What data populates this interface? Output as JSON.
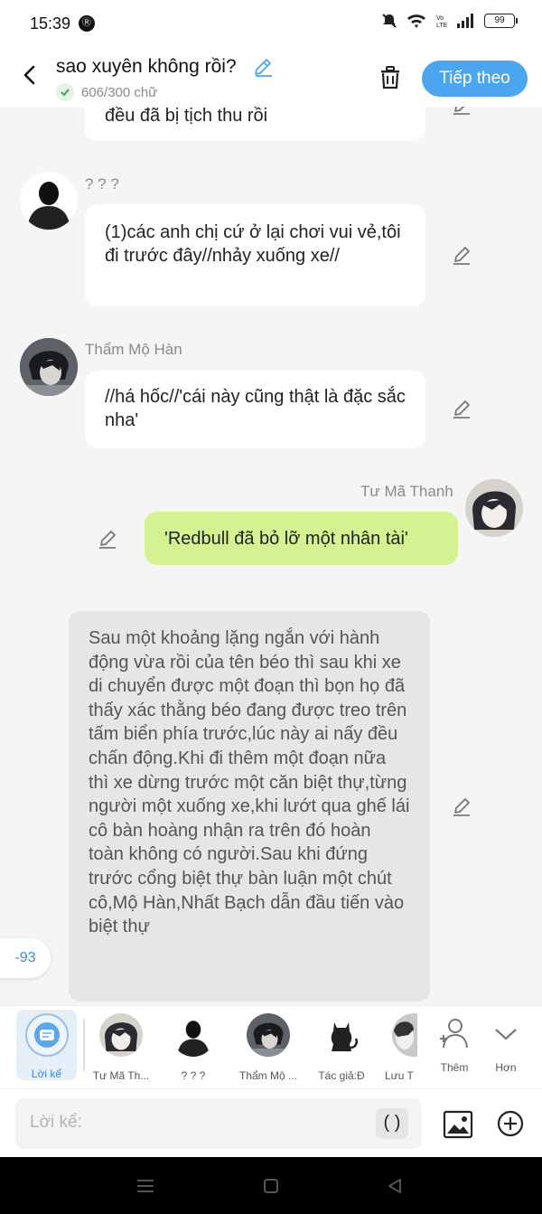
{
  "status_bar": {
    "time": "15:39",
    "battery": "99",
    "app_badge": "Ⓡ"
  },
  "header": {
    "title": "sao xuyên không rồi?",
    "word_count": "606/300 chữ",
    "next_button": "Tiếp theo",
    "icons": [
      "back-icon",
      "pencil-icon",
      "trash-icon"
    ]
  },
  "messages": [
    {
      "type": "bubble",
      "text": "đều đã bị tịch thu rồi"
    },
    {
      "type": "bubble",
      "speaker": "? ? ?",
      "text": "(1)các anh chị cứ ở lại chơi vui vẻ,tôi đi trước đây//nhảy xuống xe//"
    },
    {
      "type": "bubble",
      "speaker": "Thẩm Mộ Hàn",
      "text": "//há hốc//'cái này cũng thật là đặc sắc nha'"
    },
    {
      "type": "bubble-right",
      "speaker": "Tư Mã Thanh",
      "text": "'Redbull đã bỏ lỡ một nhân tài'"
    },
    {
      "type": "narration",
      "text": "Sau một khoảng lặng ngắn với hành động vừa rồi của tên béo thì sau khi xe di chuyển được một đoạn thì bọn họ đã thấy xác thằng béo đang được treo trên tấm biển phía trước,lúc này ai nấy đều chấn động.Khi đi thêm một đoạn nữa thì xe dừng trước một căn biệt thự,từng người một xuống xe,khi lướt qua ghế lái cô bàn hoàng nhận ra trên đó hoàn toàn không có người.Sau khi đứng trước cổng biệt thự bàn luận một chút cô,Mộ Hàn,Nhất Bạch dẫn đầu tiến vào biệt thự"
    }
  ],
  "counter": "-93",
  "characters": [
    {
      "label": "Lời kể",
      "active": true
    },
    {
      "label": "Tư Mã Th..."
    },
    {
      "label": "? ? ?"
    },
    {
      "label": "Thẩm Mộ ..."
    },
    {
      "label": "Tác giả:Đ"
    },
    {
      "label": "Lưu T"
    },
    {
      "label": "Thêm"
    },
    {
      "label": "Hơn"
    }
  ],
  "input": {
    "placeholder": "Lời kể:",
    "paren_button": "( )"
  },
  "colors": {
    "accent": "#4ba6ef",
    "right_bubble": "#d4f291",
    "narration_bg": "#e6e6e6"
  }
}
